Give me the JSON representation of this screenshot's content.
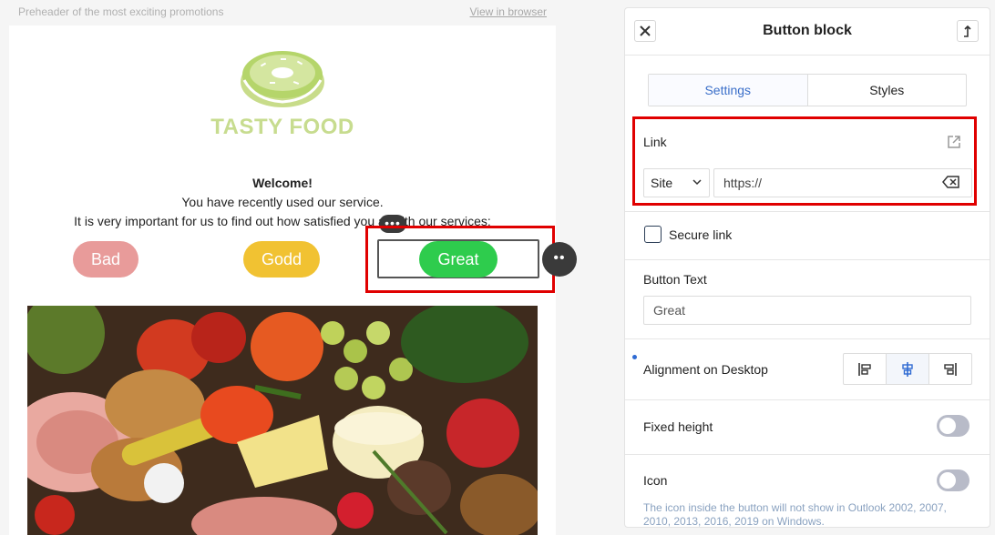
{
  "preheader": {
    "text": "Preheader of the most exciting promotions",
    "view_link": "View in browser"
  },
  "email": {
    "logo_text": "TASTY FOOD",
    "welcome_title": "Welcome!",
    "line1": "You have recently used our service.",
    "line2": "It is very important for us to find out how satisfied you a",
    "line2_tail": "ith our services:",
    "buttons": [
      {
        "label": "Bad",
        "color": "#e89b9a"
      },
      {
        "label": "Godd",
        "color": "#f1c232"
      },
      {
        "label": "Great",
        "color": "#2ecc4d"
      }
    ],
    "dots": "•••",
    "dots_round": "••"
  },
  "panel": {
    "title": "Button block",
    "tabs": [
      {
        "label": "Settings",
        "active": true
      },
      {
        "label": "Styles",
        "active": false
      }
    ],
    "link": {
      "label": "Link",
      "protocol": "Site",
      "url_value": "https://"
    },
    "secure_link": {
      "label": "Secure link",
      "checked": false
    },
    "button_text": {
      "label": "Button Text",
      "value": "Great"
    },
    "alignment": {
      "label": "Alignment on Desktop",
      "selected": "center"
    },
    "fixed_height": {
      "label": "Fixed height",
      "enabled": false
    },
    "icon": {
      "label": "Icon",
      "enabled": false,
      "note": "The icon inside the button will not show in Outlook 2002, 2007, 2010, 2013, 2016, 2019 on Windows."
    },
    "accent_color": "#3b6fc9",
    "highlight_color": "#e00000"
  },
  "icons": [
    "close-icon",
    "move-icon",
    "external-link-icon",
    "chevron-down-icon",
    "clear-icon",
    "align-left-icon",
    "align-center-icon",
    "align-right-icon",
    "donut-logo"
  ]
}
